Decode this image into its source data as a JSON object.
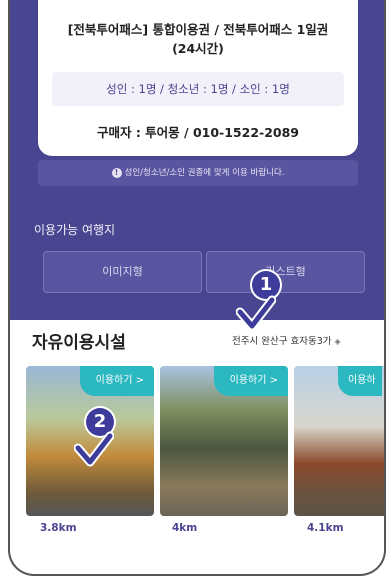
{
  "ticket": {
    "title_line1": "[전북투어패스] 통합이용권 / 전북투어패스 1일권",
    "title_line2": "(24시간)",
    "counts": "성인 : 1명 / 청소년 : 1명 / 소인 : 1명",
    "buyer": "구매자 : 투어몽 / 010-1522-2089"
  },
  "notice": {
    "icon": "info-icon",
    "text": "성인/청소년/소인 권종에 맞게 이용 바랍니다."
  },
  "destinations": {
    "label": "이용가능 여행지",
    "image_view_label": "이미지형",
    "list_view_label": "리스트형"
  },
  "facilities": {
    "title": "자유이용시설",
    "location": "전주시 완산구 효자동3가",
    "location_icon": "location-target-icon",
    "cards": [
      {
        "badge": "이용하기 >",
        "distance": "3.8km"
      },
      {
        "badge": "이용하기 >",
        "distance": "4km"
      },
      {
        "badge": "이용하",
        "distance": "4.1km"
      }
    ]
  },
  "annotations": {
    "marker_1": "1",
    "marker_2": "2"
  },
  "colors": {
    "primary": "#4a4591",
    "accent": "#2bb8c0",
    "marker": "#3d3c9a"
  }
}
